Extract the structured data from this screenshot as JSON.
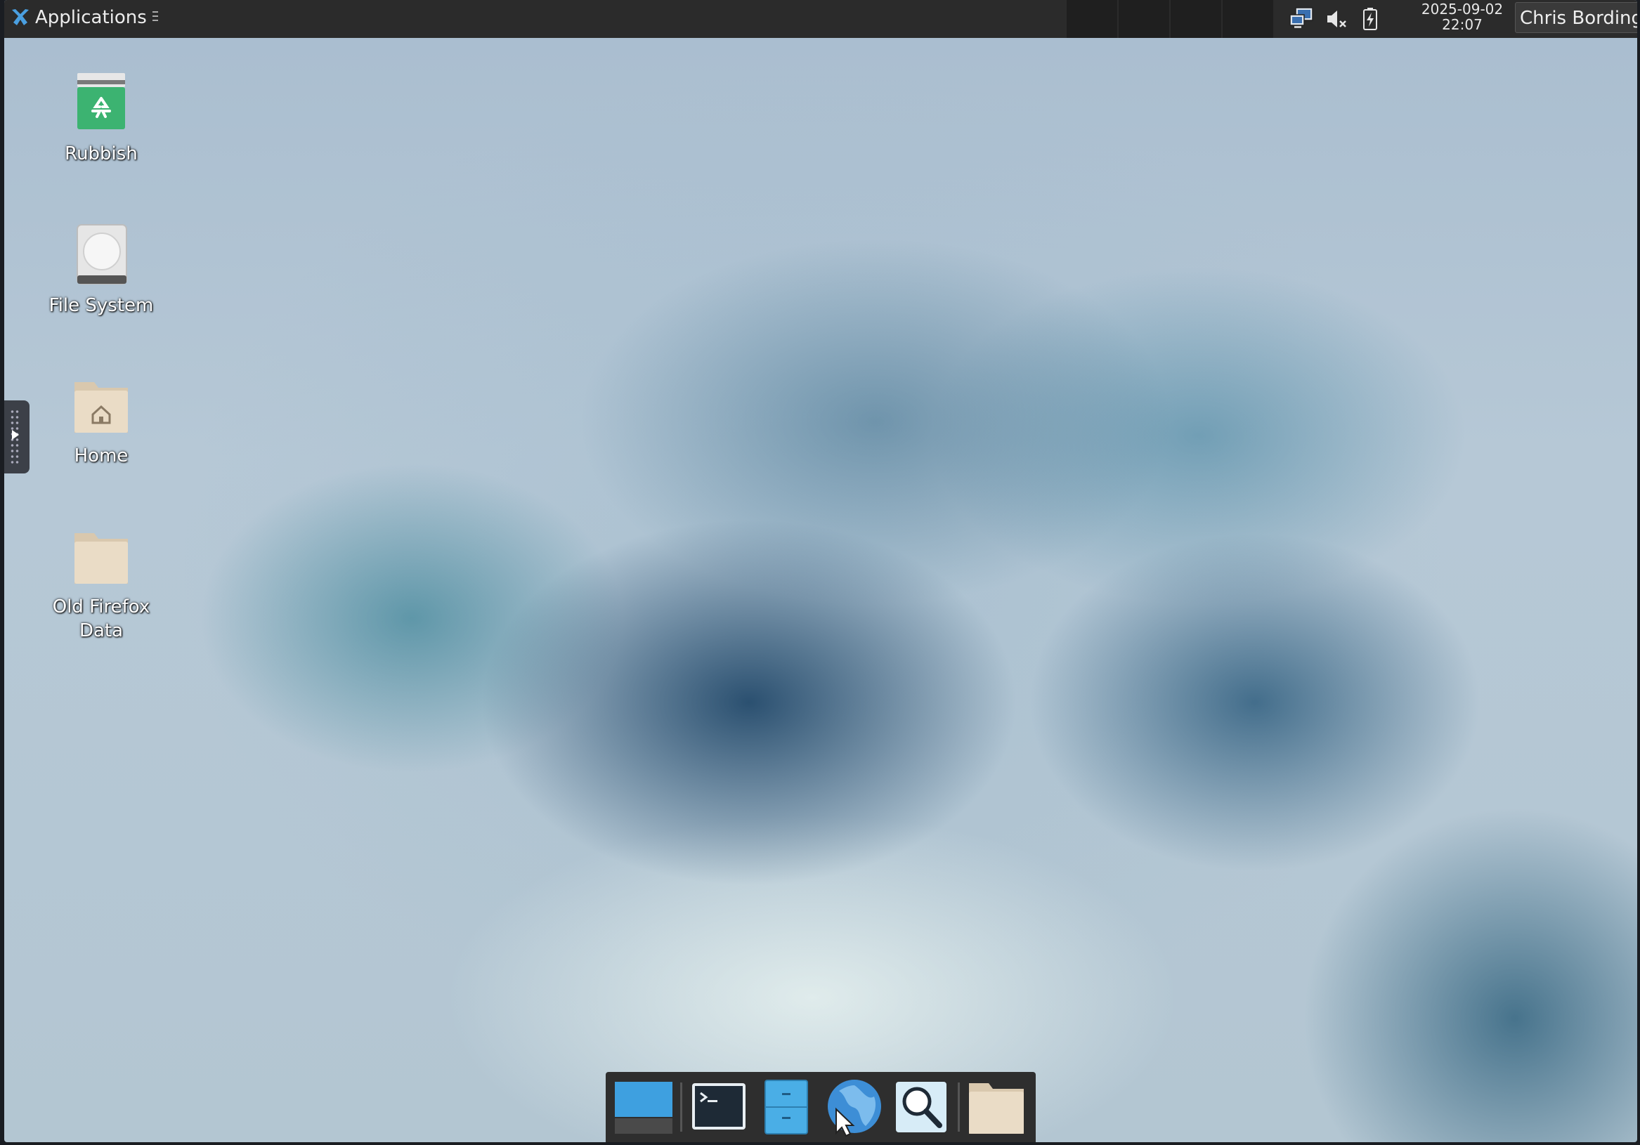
{
  "top_panel": {
    "applications_label": "Applications",
    "clock_date": "2025-09-02",
    "clock_time": "22:07",
    "user_name": "Chris Bording",
    "tray_icons": [
      "network-icon",
      "volume-muted-icon",
      "battery-charging-icon"
    ]
  },
  "desktop": {
    "icons": [
      {
        "label": "Rubbish",
        "icon": "rubbish-bin-icon"
      },
      {
        "label": "File System",
        "icon": "hard-drive-icon"
      },
      {
        "label": "Home",
        "icon": "home-folder-icon"
      },
      {
        "label": "Old Firefox Data",
        "icon": "folder-icon"
      }
    ]
  },
  "dock": {
    "items": [
      "show-desktop-icon",
      "terminal-icon",
      "file-manager-icon",
      "web-browser-icon",
      "app-finder-icon",
      "folder-icon"
    ]
  },
  "colors": {
    "panel": "#2b2b2b",
    "dock": "#2e2e2e",
    "folder": "#e8d8c0",
    "accent_blue": "#3ea0e0"
  }
}
